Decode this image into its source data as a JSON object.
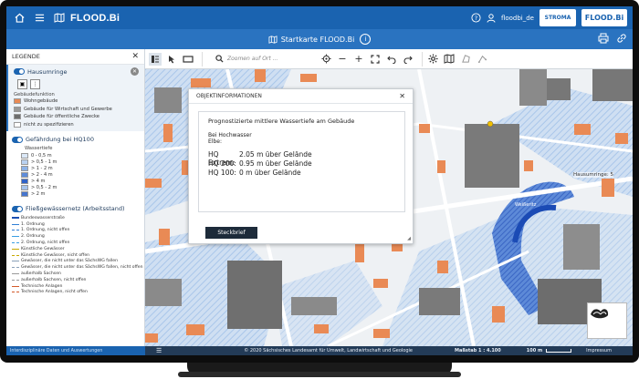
{
  "header": {
    "brand": "FLOOD.Bi",
    "user": "floodbi_de",
    "logo1": "STROMA",
    "logo2": "FLOOD.Bi"
  },
  "subbar": {
    "title": "Startkarte FLOOD.Bi"
  },
  "legend": {
    "title": "LEGENDE",
    "hausumringe": {
      "title": "Hausumringe",
      "subtitle": "Gebäudefunktion",
      "items": [
        {
          "label": "Wohngebäude",
          "color": "#e98a55"
        },
        {
          "label": "Gebäude für Wirtschaft und Gewerbe",
          "color": "#9a9a9a"
        },
        {
          "label": "Gebäude für öffentliche Zwecke",
          "color": "#6d6d6d"
        },
        {
          "label": "nicht zu spezifizieren",
          "color": "#ffffff"
        }
      ]
    },
    "gefaehrdung": {
      "title": "Gefährdung bei HQ100",
      "subtitle": "Wassertiefe",
      "items": [
        {
          "label": "0 - 0,5 m",
          "color": "#dbe8f7"
        },
        {
          "label": "> 0,5 - 1 m",
          "color": "#b9d1f0"
        },
        {
          "label": "> 1 - 2 m",
          "color": "#8db2e6"
        },
        {
          "label": "> 2 - 4 m",
          "color": "#5e8cd9"
        },
        {
          "label": "> 4 m",
          "color": "#2f62c8"
        },
        {
          "label": "> 0,5 - 2 m",
          "color": "#a6c3ec"
        },
        {
          "label": "> 2 m",
          "color": "#4676cf"
        }
      ]
    },
    "fliess": {
      "title": "Fließgewässernetz (Arbeitsstand)",
      "items": [
        {
          "label": "Bundeswasserstraße",
          "color": "#1a4fb3"
        },
        {
          "label": "1. Ordnung",
          "color": "#2f7fd6"
        },
        {
          "label": "1. Ordnung, nicht offen",
          "color": "#2f7fd6"
        },
        {
          "label": "2. Ordnung",
          "color": "#3a9ee3"
        },
        {
          "label": "2. Ordnung, nicht offen",
          "color": "#3a9ee3"
        },
        {
          "label": "Künstliche Gewässer",
          "color": "#c7a800"
        },
        {
          "label": "Künstliche Gewässer, nicht offen",
          "color": "#c7a800"
        },
        {
          "label": "Gewässer, die nicht unter das SächsWG fallen",
          "color": "#8aa0b8"
        },
        {
          "label": "Gewässer, die nicht unter das SächsWG fallen, nicht offen",
          "color": "#8aa0b8"
        },
        {
          "label": "außerhalb Sachsen",
          "color": "#9a9a9a"
        },
        {
          "label": "außerhalb Sachsen, nicht offen",
          "color": "#9a9a9a"
        },
        {
          "label": "Technische Anlagen",
          "color": "#d35a2a"
        },
        {
          "label": "Technische Anlagen, nicht offen",
          "color": "#d35a2a"
        }
      ]
    }
  },
  "toolbar": {
    "search_placeholder": "Zoomen auf Ort ..."
  },
  "popup": {
    "title": "OBJEKTINFORMATIONEN",
    "heading": "Prognostizierte mittlere Wassertiefe am Gebäude",
    "sub1": "Bei Hochwasser",
    "sub2": "Elbe:",
    "rows": [
      {
        "key": "HQ Extrem:",
        "value": "2.05 m über Gelände"
      },
      {
        "key": "HQ 200:",
        "value": "0.95 m über Gelände"
      },
      {
        "key": "HQ 100:",
        "value": "0 m über Gelände"
      }
    ],
    "button": "Steckbrief"
  },
  "map": {
    "hq_label": "Hausumringe: 5",
    "water_label": "Weißeritz"
  },
  "footer": {
    "left": "Interdisziplinäre Daten und Auswertungen",
    "center": "© 2020 Sächsisches Landesamt für Umwelt, Landwirtschaft und Geologie",
    "scale": "Maßstab 1 : 4.100",
    "scalebar": "100 m",
    "impressum": "Impressum"
  }
}
